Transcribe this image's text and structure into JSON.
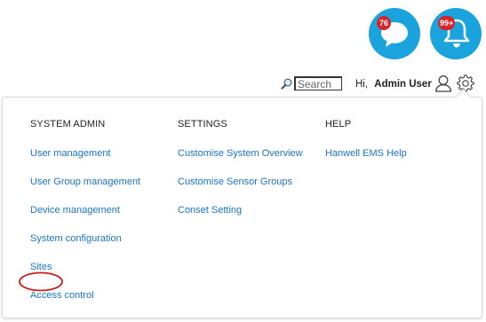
{
  "notifications": {
    "messages_count": "76",
    "alerts_count": "99+",
    "accent_color": "#1aa3dc",
    "badge_color": "#d9232a",
    "message_icon": "chat-bubble-icon",
    "alert_icon": "bell-icon"
  },
  "header": {
    "search_placeholder": "Search",
    "greeting_prefix": "Hi,",
    "user_name": "Admin User",
    "user_icon": "user-icon",
    "settings_icon": "gear-icon"
  },
  "menu": {
    "columns": [
      {
        "heading": "SYSTEM ADMIN",
        "items": [
          "User management",
          "User Group management",
          "Device management",
          "System configuration",
          "Sites",
          "Access control"
        ]
      },
      {
        "heading": "SETTINGS",
        "items": [
          "Customise System Overview",
          "Customise Sensor Groups",
          "Conset Setting"
        ]
      },
      {
        "heading": "HELP",
        "items": [
          "Hanwell EMS Help"
        ]
      }
    ],
    "link_color": "#1a74c8",
    "highlight_color": "#cc1f1f"
  }
}
